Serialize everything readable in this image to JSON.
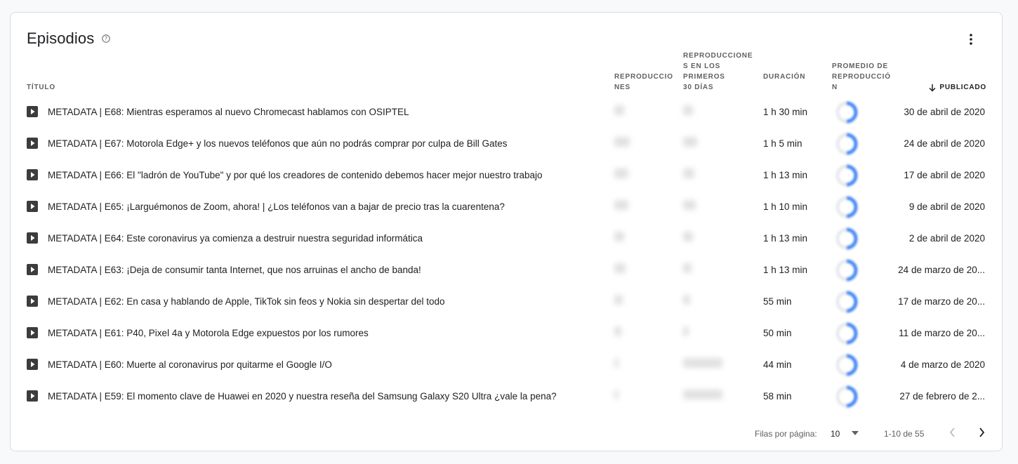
{
  "header": {
    "title": "Episodios",
    "help_icon": "help-circle-icon",
    "menu_icon": "more-vert-icon"
  },
  "columns": {
    "title": "TÍTULO",
    "plays": [
      "REPRODUCCIO",
      "NES"
    ],
    "plays30": [
      "REPRODUCCIONE",
      "S EN LOS",
      "PRIMEROS",
      "30 DÍAS"
    ],
    "duration": "DURACIÓN",
    "avg": [
      "PROMEDIO DE",
      "REPRODUCCIÓ",
      "N"
    ],
    "published": "PUBLICADO",
    "sort_icon": "arrow-down-icon"
  },
  "rows": [
    {
      "title": "METADATA | E68: Mientras esperamos al nuevo Chromecast hablamos con OSIPTEL",
      "duration": "1 h 30 min",
      "published": "30 de abril de 2020"
    },
    {
      "title": "METADATA | E67: Motorola Edge+ y los nuevos teléfonos que aún no podrás comprar por culpa de Bill Gates",
      "duration": "1 h 5 min",
      "published": "24 de abril de 2020"
    },
    {
      "title": "METADATA | E66: El \"ladrón de YouTube\" y por qué los creadores de contenido debemos hacer mejor nuestro trabajo",
      "duration": "1 h 13 min",
      "published": "17 de abril de 2020"
    },
    {
      "title": "METADATA | E65: ¡Larguémonos de Zoom, ahora! | ¿Los teléfonos van a bajar de precio tras la cuarentena?",
      "duration": "1 h 10 min",
      "published": "9 de abril de 2020"
    },
    {
      "title": "METADATA | E64: Este coronavirus ya comienza a destruir nuestra seguridad informática",
      "duration": "1 h 13 min",
      "published": "2 de abril de 2020"
    },
    {
      "title": "METADATA | E63: ¡Deja de consumir tanta Internet, que nos arruinas el ancho de banda!",
      "duration": "1 h 13 min",
      "published": "24 de marzo de 20..."
    },
    {
      "title": "METADATA | E62: En casa y hablando de Apple, TikTok sin feos y Nokia sin despertar del todo",
      "duration": "55 min",
      "published": "17 de marzo de 20..."
    },
    {
      "title": "METADATA | E61: P40, Pixel 4a y Motorola Edge expuestos por los rumores",
      "duration": "50 min",
      "published": "11 de marzo de 20..."
    },
    {
      "title": "METADATA | E60: Muerte al coronavirus por quitarme el Google I/O",
      "duration": "44 min",
      "published": "4 de marzo de 2020"
    },
    {
      "title": "METADATA | E59: El momento clave de Huawei en 2020 y nuestra reseña del Samsung Galaxy S20 Ultra ¿vale la pena?",
      "duration": "58 min",
      "published": "27 de febrero de 2..."
    }
  ],
  "footer": {
    "rows_per_page_label": "Filas por página:",
    "rows_per_page_value": "10",
    "range": "1-10 de 55",
    "prev_icon": "chevron-left-icon",
    "next_icon": "chevron-right-icon"
  },
  "colors": {
    "accent_blue": "#4285f4",
    "text": "#202124",
    "muted": "#606060",
    "border": "#dadce0"
  }
}
